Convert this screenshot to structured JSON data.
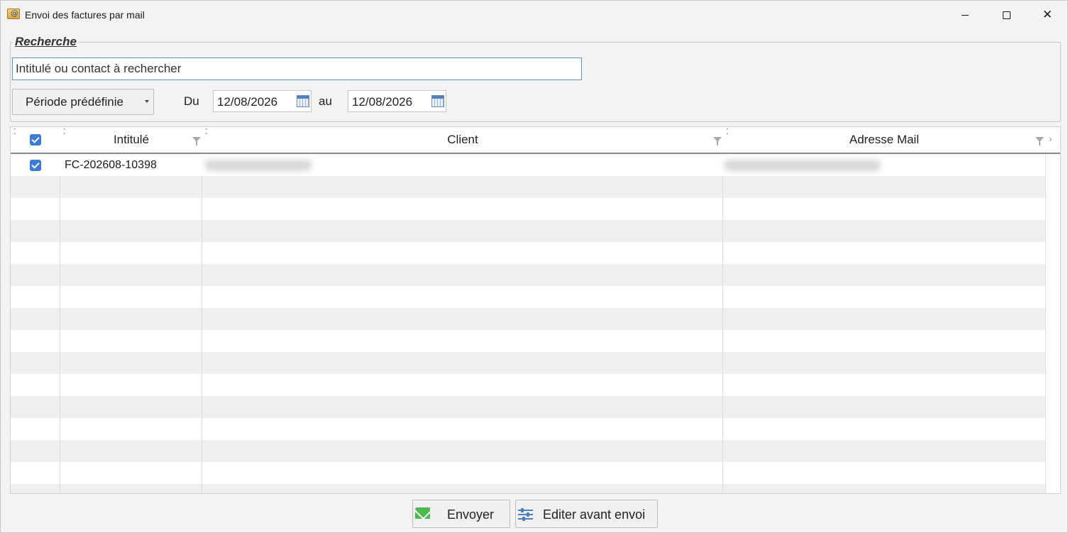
{
  "window": {
    "title": "Envoi des factures par mail"
  },
  "search": {
    "legend": "Recherche",
    "placeholder": "Intitulé ou contact à rechercher",
    "period_label": "Période prédéfinie",
    "from_label": "Du",
    "from_date": "12/08/2026",
    "to_label": "au",
    "to_date": "12/08/2026"
  },
  "grid": {
    "columns": [
      "Intitulé",
      "Client",
      "Adresse Mail"
    ],
    "header_checked": true,
    "rows": [
      {
        "checked": true,
        "intitule": "FC-202608-10398",
        "client": "",
        "mail": ""
      }
    ]
  },
  "actions": {
    "send_label": "Envoyer",
    "edit_label": "Editer avant envoi"
  },
  "colors": {
    "accent": "#3d7bd9",
    "row_alt": "#efefef",
    "send_icon": "#4cb84e"
  }
}
